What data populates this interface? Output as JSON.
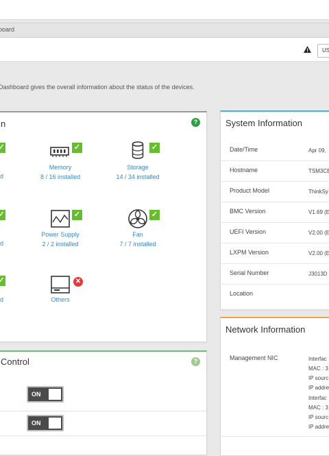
{
  "breadcrumb": "board",
  "header": {
    "language": "US"
  },
  "description": "Dashboard gives the overall information about the status of the devices.",
  "hardware": {
    "title_fragment": "n",
    "devices": [
      {
        "name": "Memory",
        "status_text": "8 / 16 installed",
        "status": "ok"
      },
      {
        "name": "Storage",
        "status_text": "14 / 34 installed",
        "status": "ok"
      },
      {
        "name": "Power Supply",
        "status_text": "2 / 2 installed",
        "status": "ok"
      },
      {
        "name": "Fan",
        "status_text": "7 / 7 installed",
        "status": "ok"
      },
      {
        "name": "Others",
        "status_text": "",
        "status": "error"
      }
    ],
    "left_cut_labels": [
      "d",
      "d",
      "d"
    ]
  },
  "power_control": {
    "title_fragment": "Control",
    "toggles": [
      {
        "label": "ON"
      },
      {
        "label": "ON"
      }
    ]
  },
  "system_information": {
    "title": "System Information",
    "rows": [
      {
        "key": "Date/Time",
        "value": "Apr 09,"
      },
      {
        "key": "Hostname",
        "value": "TSM3CE"
      },
      {
        "key": "Product Model",
        "value": "ThinkSy"
      },
      {
        "key": "BMC Version",
        "value": "V1.69 (E"
      },
      {
        "key": "UEFI Version",
        "value": "V2.00 (E"
      },
      {
        "key": "LXPM Version",
        "value": "V2.00 (E"
      },
      {
        "key": "Serial Number",
        "value": "J3013D"
      },
      {
        "key": "Location",
        "value": ""
      }
    ]
  },
  "network_information": {
    "title": "Network Information",
    "key": "Management NIC",
    "lines": [
      "Interfac",
      "MAC : 3",
      "IP sourc",
      "IP addre",
      "Interfac",
      "MAC : 3",
      "IP sourc",
      "IP addre"
    ]
  },
  "colors": {
    "ok": "#65bd2f",
    "error": "#e23a3a",
    "link": "#3a87c8",
    "system_accent": "#3cb5e8",
    "network_accent": "#f0a04b",
    "power_accent": "#6dbf6d"
  }
}
